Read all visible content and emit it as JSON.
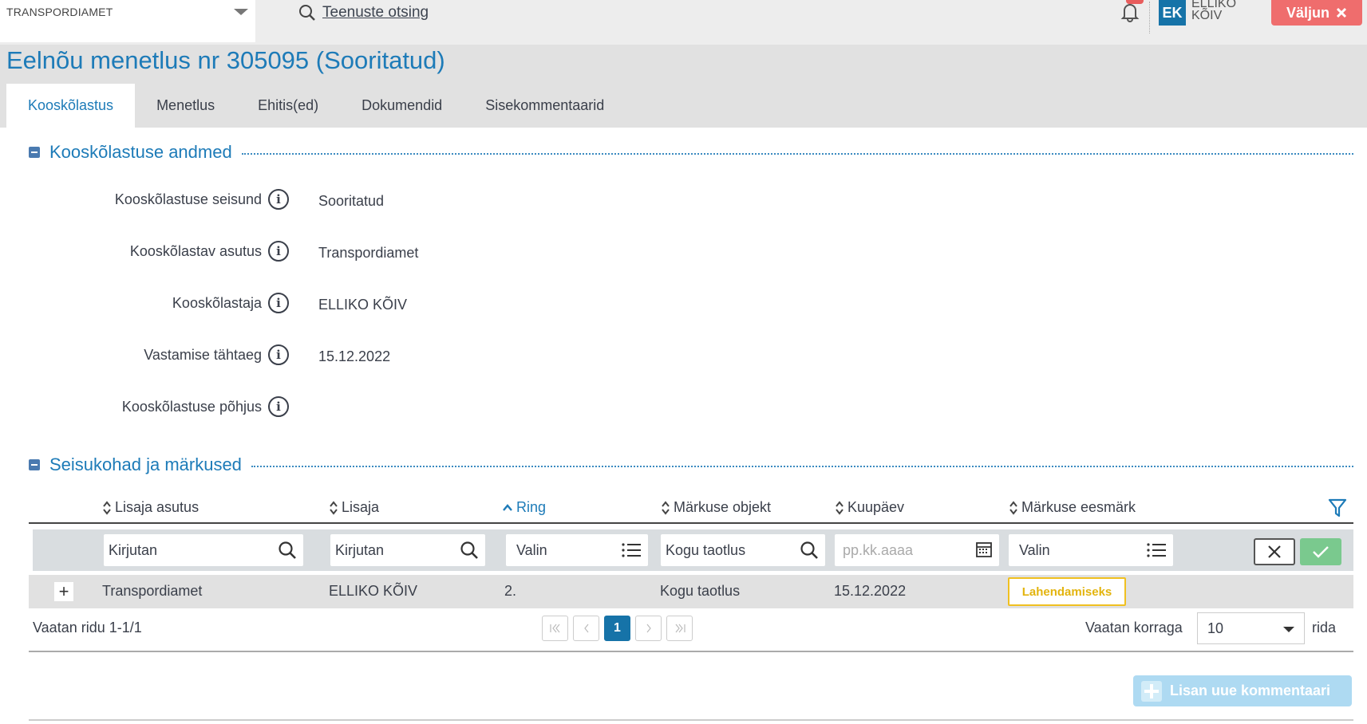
{
  "topbar": {
    "org": "TRANSPORDIAMET",
    "service_search": "Teenuste otsing",
    "user_initials": "EK",
    "user_name": "ELLIKO KÕIV",
    "logout": "Väljun"
  },
  "page": {
    "title": "Eelnõu menetlus nr 305095 (Sooritatud)"
  },
  "tabs": [
    {
      "label": "Kooskõlastus",
      "active": true
    },
    {
      "label": "Menetlus"
    },
    {
      "label": "Ehitis(ed)"
    },
    {
      "label": "Dokumendid"
    },
    {
      "label": "Sisekommentaarid"
    }
  ],
  "section1": {
    "title": "Kooskõlastuse andmed",
    "fields": [
      {
        "label": "Kooskõlastuse seisund",
        "value": "Sooritatud"
      },
      {
        "label": "Kooskõlastav asutus",
        "value": "Transpordiamet"
      },
      {
        "label": "Kooskõlastaja",
        "value": "ELLIKO KÕIV"
      },
      {
        "label": "Vastamise tähtaeg",
        "value": "15.12.2022"
      },
      {
        "label": "Kooskõlastuse põhjus",
        "value": ""
      }
    ]
  },
  "section2": {
    "title": "Seisukohad ja märkused",
    "columns": [
      "Lisaja asutus",
      "Lisaja",
      "Ring",
      "Märkuse objekt",
      "Kuupäev",
      "Märkuse eesmärk"
    ],
    "filters": {
      "lisaja_asutus": "Kirjutan",
      "lisaja": "Kirjutan",
      "ring": "Valin",
      "objekt": "Kogu taotlus",
      "kuupaev_placeholder": "pp.kk.aaaa",
      "eesmark": "Valin"
    },
    "rows": [
      {
        "asutus": "Transpordiamet",
        "lisaja": "ELLIKO KÕIV",
        "ring": "2.",
        "objekt": "Kogu taotlus",
        "kuupaev": "15.12.2022",
        "eesmark": "Lahendamiseks"
      }
    ],
    "pager": {
      "info": "Vaatan ridu 1-1/1",
      "current_page": "1",
      "per_page_label": "Vaatan korraga",
      "per_page": "10",
      "rows_suffix": "rida"
    },
    "add_comment": "Lisan uue kommentaari"
  }
}
